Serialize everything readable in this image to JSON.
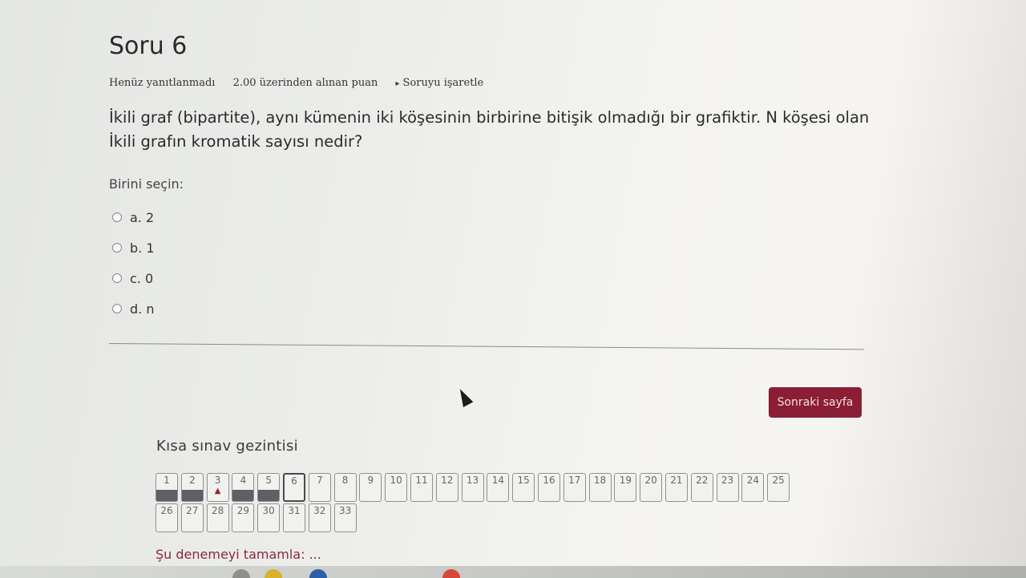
{
  "question": {
    "title": "Soru 6",
    "status": "Henüz yanıtlanmadı",
    "score": "2.00 üzerinden alınan puan",
    "flag_label": "Soruyu işaretle",
    "flag_icon": "flag-icon",
    "text": "İkili graf (bipartite), aynı kümenin iki köşesinin birbirine bitişik olmadığı bir grafiktir. N köşesi olan İkili grafın kromatik sayısı nedir?",
    "prompt": "Birini seçin:",
    "options": [
      {
        "label": "a. 2"
      },
      {
        "label": "b. 1"
      },
      {
        "label": "c. 0"
      },
      {
        "label": "d. n"
      }
    ]
  },
  "next_button": "Sonraki sayfa",
  "quiz_nav": {
    "title": "Kısa sınav gezintisi",
    "row1": [
      "1",
      "2",
      "3",
      "4",
      "5",
      "6",
      "7",
      "8",
      "9",
      "10",
      "11",
      "12",
      "13",
      "14",
      "15",
      "16",
      "17",
      "18",
      "19",
      "20",
      "21",
      "22",
      "23",
      "24",
      "25"
    ],
    "row2": [
      "26",
      "27",
      "28",
      "29",
      "30",
      "31",
      "32",
      "33"
    ],
    "answered": [
      1,
      2,
      4,
      5
    ],
    "flagged": [
      3
    ],
    "current": 6,
    "finish_link": "Şu denemeyi tamamla: ..."
  },
  "colors": {
    "accent": "#8b1d34",
    "answered_fill": "#5d6064",
    "flag_mark": "#9a1f2e"
  }
}
